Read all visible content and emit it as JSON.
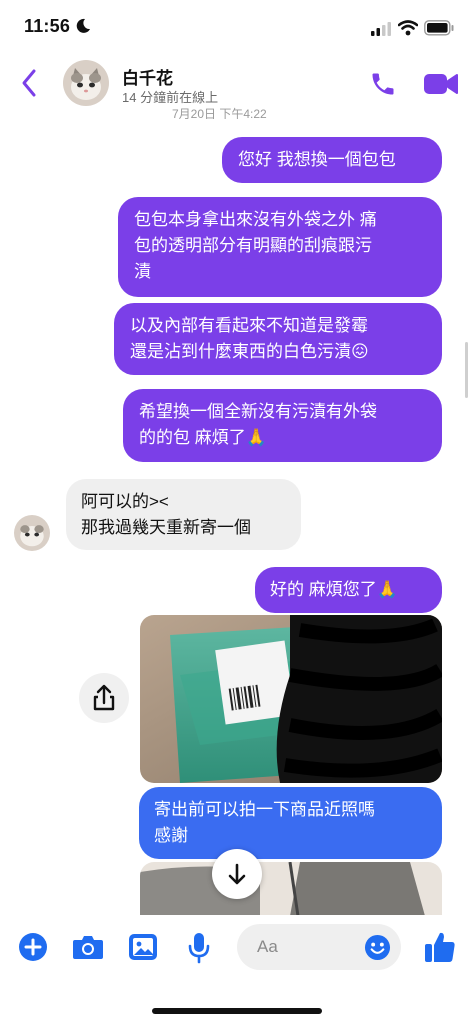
{
  "status_bar": {
    "time": "11:56"
  },
  "header": {
    "contact_name": "白千花",
    "contact_status": "14 分鐘前在線上",
    "date_partial": "7月20日 下午4:22"
  },
  "messages": [
    {
      "text": "您好 我想換一個包包"
    },
    {
      "text": "包包本身拿出來沒有外袋之外 痛\n包的透明部分有明顯的刮痕跟污\n漬"
    },
    {
      "text": "以及內部有看起來不知道是發霉\n還是沾到什麼東西的白色污漬😖"
    },
    {
      "text": "希望換一個全新沒有污漬有外袋\n的的包 麻煩了🙏"
    },
    {
      "text": "阿可以的><\n那我過幾天重新寄一個"
    },
    {
      "text": "好的 麻煩您了🙏"
    },
    {
      "text": "寄出前可以拍一下商品近照嗎\n感謝"
    }
  ],
  "composer": {
    "placeholder": "Aa"
  },
  "colors": {
    "accent": "#7b3fe8",
    "blue": "#3a6cf1",
    "icon_blue": "#1f6cf0"
  }
}
